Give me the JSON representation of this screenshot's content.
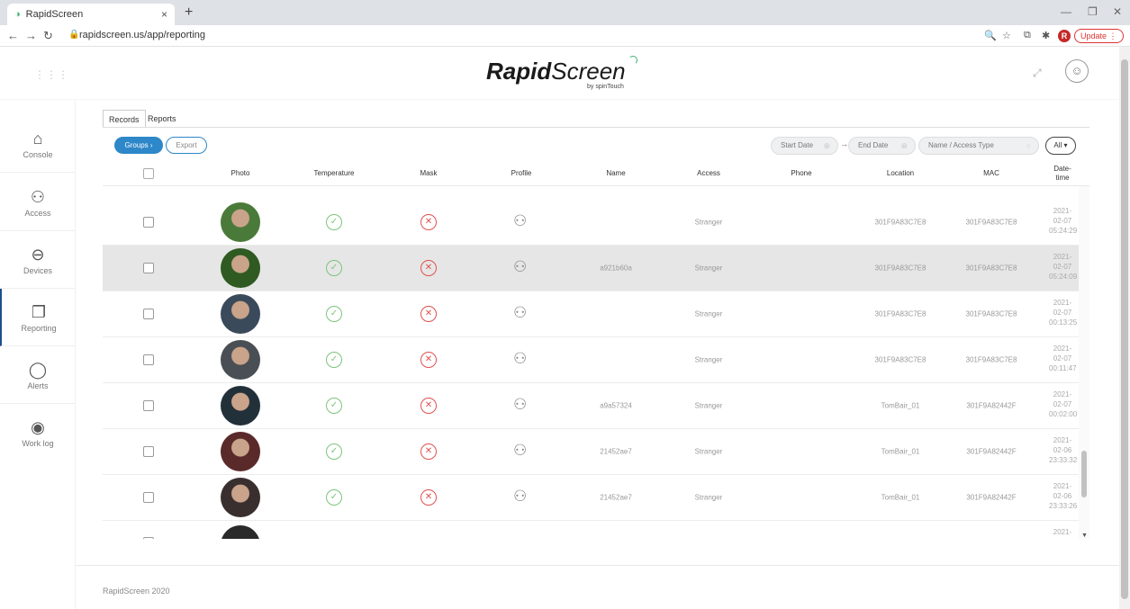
{
  "browser": {
    "tab_title": "RapidScreen",
    "url": "rapidscreen.us/app/reporting",
    "update_label": "Update",
    "profile_initial": "R"
  },
  "header": {
    "logo_bold": "Rapid",
    "logo_light": "Screen",
    "logo_sub": "by spinTouch"
  },
  "sidebar": {
    "items": [
      {
        "label": "Console",
        "icon": "house-icon"
      },
      {
        "label": "Access",
        "icon": "users-icon"
      },
      {
        "label": "Devices",
        "icon": "device-icon"
      },
      {
        "label": "Reporting",
        "icon": "report-icon"
      },
      {
        "label": "Alerts",
        "icon": "chat-bubble-icon"
      },
      {
        "label": "Work log",
        "icon": "eye-icon"
      }
    ]
  },
  "tabs": {
    "records": "Records",
    "reports": "Reports"
  },
  "toolbar": {
    "groups_label": "Groups ›",
    "export_label": "Export",
    "start_date": "Start Date",
    "end_date": "End Date",
    "name_filter": "Name / Access Type",
    "all_label": "All ▾"
  },
  "table": {
    "headers": {
      "photo": "Photo",
      "temperature": "Temperature",
      "mask": "Mask",
      "profile": "Profile",
      "name": "Name",
      "access": "Access",
      "phone": "Phone",
      "location": "Location",
      "mac": "MAC",
      "datetime": "Date-\ntime"
    },
    "rows": [
      {
        "name": "",
        "access": "Stranger",
        "phone": "",
        "location": "301F9A83C7E8",
        "mac": "301F9A83C7E8",
        "datetime": "2021-\n02-07\n05:24:29",
        "highlight": false
      },
      {
        "name": "a921b60a",
        "access": "Stranger",
        "phone": "",
        "location": "301F9A83C7E8",
        "mac": "301F9A83C7E8",
        "datetime": "2021-\n02-07\n05:24:09",
        "highlight": true
      },
      {
        "name": "",
        "access": "Stranger",
        "phone": "",
        "location": "301F9A83C7E8",
        "mac": "301F9A83C7E8",
        "datetime": "2021-\n02-07\n00:13:25",
        "highlight": false
      },
      {
        "name": "",
        "access": "Stranger",
        "phone": "",
        "location": "301F9A83C7E8",
        "mac": "301F9A83C7E8",
        "datetime": "2021-\n02-07\n00:11:47",
        "highlight": false
      },
      {
        "name": "a9a57324",
        "access": "Stranger",
        "phone": "",
        "location": "TomBair_01",
        "mac": "301F9A82442F",
        "datetime": "2021-\n02-07\n00:02:00",
        "highlight": false
      },
      {
        "name": "21452ae7",
        "access": "Stranger",
        "phone": "",
        "location": "TomBair_01",
        "mac": "301F9A82442F",
        "datetime": "2021-\n02-06\n23:33:32",
        "highlight": false
      },
      {
        "name": "21452ae7",
        "access": "Stranger",
        "phone": "",
        "location": "TomBair_01",
        "mac": "301F9A82442F",
        "datetime": "2021-\n02-06\n23:33:26",
        "highlight": false
      }
    ],
    "partial_last_datetime": "2021-"
  },
  "footer": {
    "text": "RapidScreen 2020"
  },
  "colors": {
    "accent": "#2d87c8",
    "ok": "#7cc47c",
    "bad": "#e05050",
    "brand_green": "#3cb371"
  }
}
